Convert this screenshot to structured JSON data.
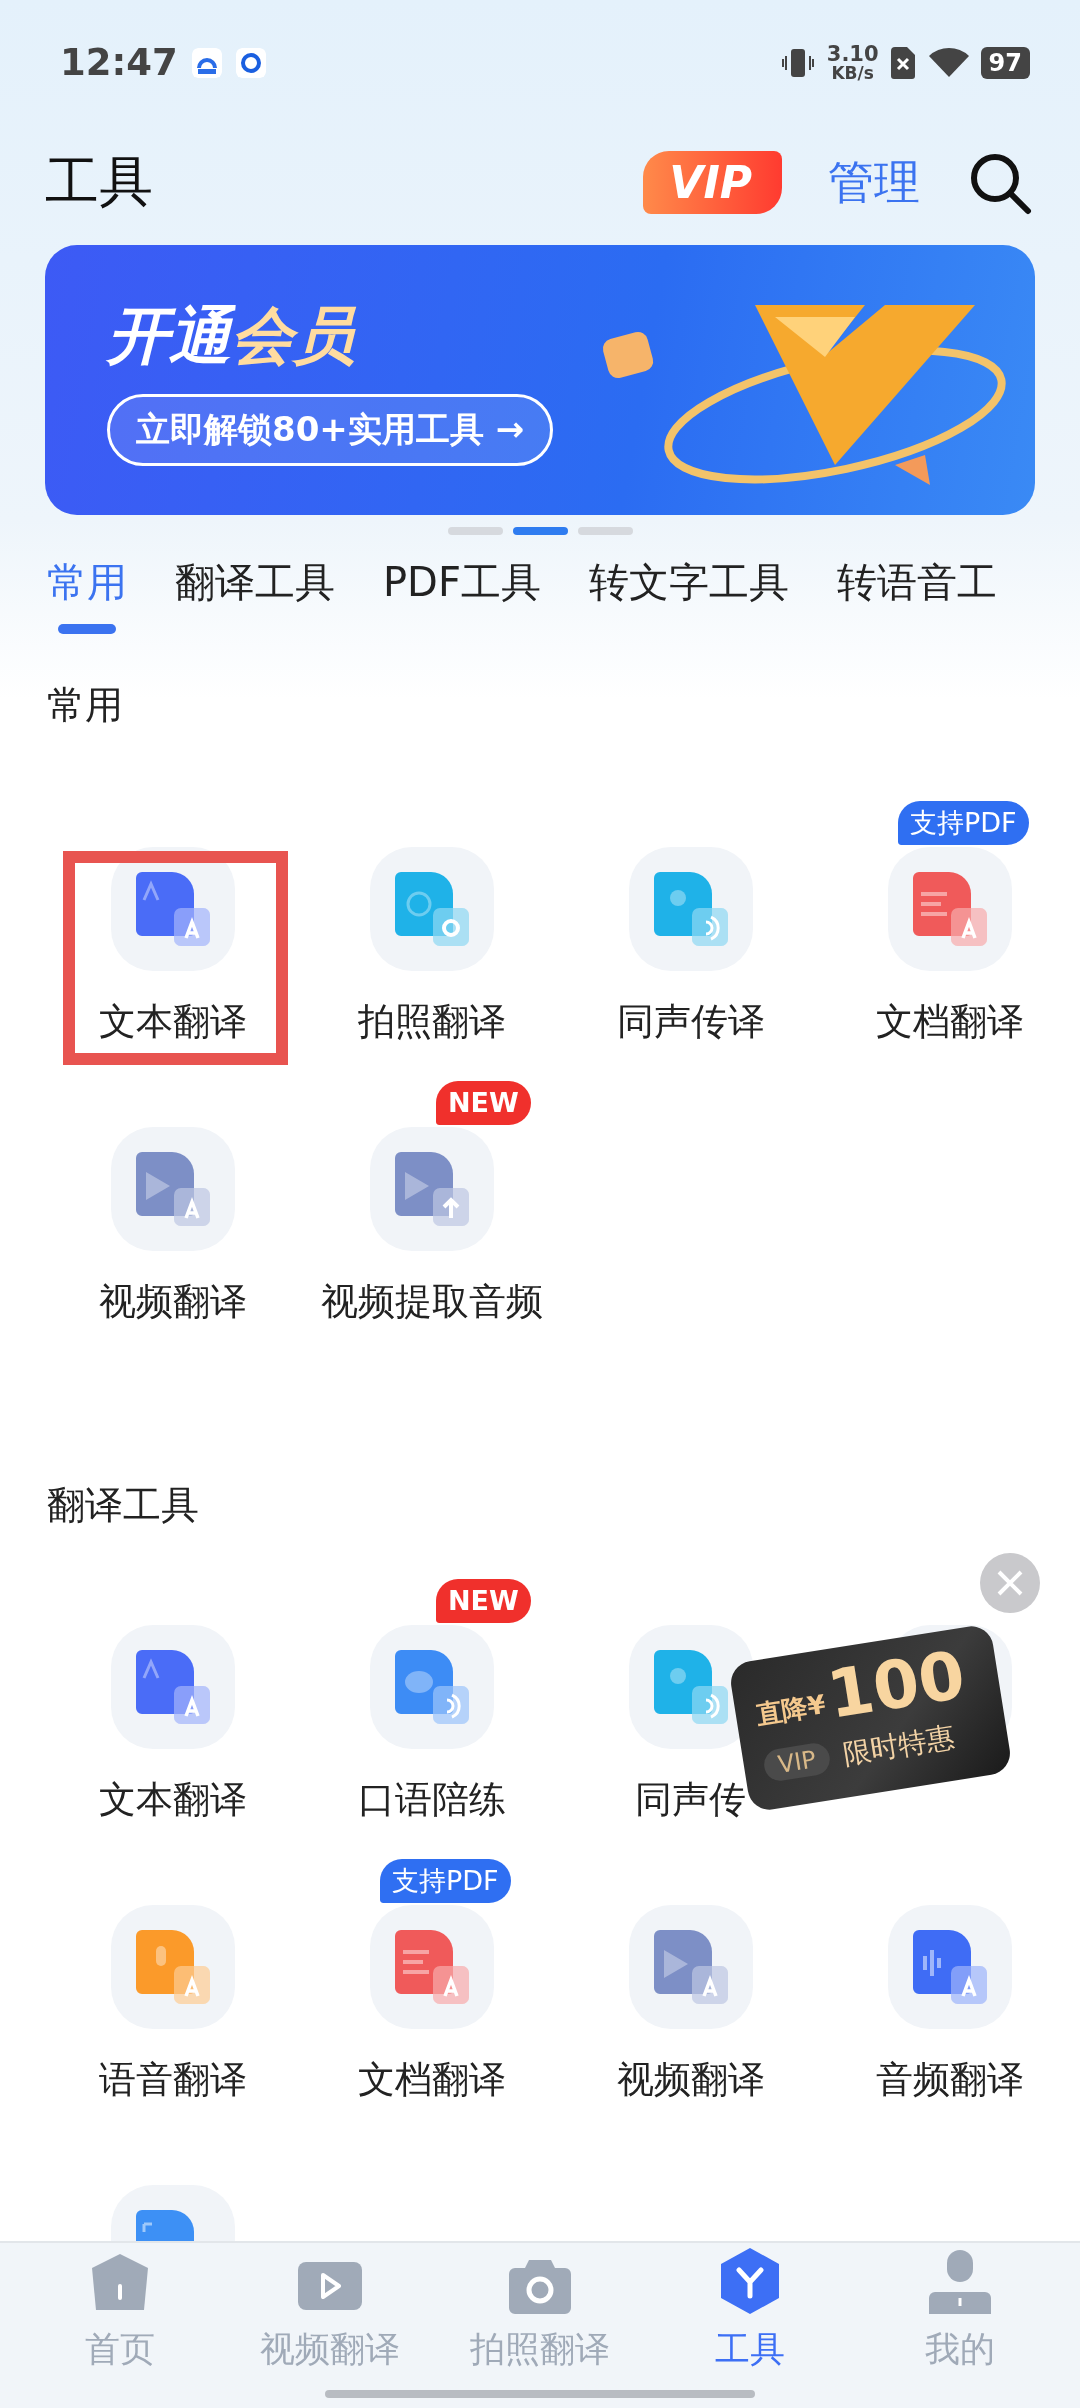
{
  "status_bar": {
    "time": "12:47",
    "net_speed": "3.10",
    "net_unit": "KB/s",
    "battery": "97"
  },
  "header": {
    "title": "工具",
    "vip_badge": "VIP",
    "manage": "管理"
  },
  "banner": {
    "title": "开通",
    "title_highlight": "会员",
    "button": "立即解锁80+实用工具 →"
  },
  "carousel_dots": [
    {
      "selected": false
    },
    {
      "selected": true
    },
    {
      "selected": false
    }
  ],
  "tabs": [
    {
      "label": "常用",
      "selected": true
    },
    {
      "label": "翻译工具",
      "selected": false
    },
    {
      "label": "PDF工具",
      "selected": false
    },
    {
      "label": "转文字工具",
      "selected": false
    },
    {
      "label": "转语音工",
      "selected": false
    }
  ],
  "sections": [
    {
      "title": "常用",
      "items": [
        {
          "label": "文本翻译",
          "kind": "text",
          "highlighted": true
        },
        {
          "label": "拍照翻译",
          "kind": "photo",
          "highlighted": false
        },
        {
          "label": "同声传译",
          "kind": "simul",
          "highlighted": false
        },
        {
          "label": "文档翻译",
          "kind": "doc",
          "highlighted": false,
          "badge": {
            "text": "支持PDF",
            "kind": "pdf"
          }
        },
        {
          "label": "视频翻译",
          "kind": "video",
          "highlighted": false
        },
        {
          "label": "视频提取音频",
          "kind": "extract",
          "highlighted": false,
          "badge": {
            "text": "NEW",
            "kind": "new"
          }
        }
      ]
    },
    {
      "title": "翻译工具",
      "items": [
        {
          "label": "文本翻译",
          "kind": "text",
          "highlighted": false
        },
        {
          "label": "口语陪练",
          "kind": "oral",
          "highlighted": false,
          "badge": {
            "text": "NEW",
            "kind": "new"
          }
        },
        {
          "label": "同声传",
          "kind": "simul",
          "highlighted": false
        },
        {
          "highlighted": false
        },
        {
          "label": "语音翻译",
          "kind": "voice",
          "highlighted": false
        },
        {
          "label": "文档翻译",
          "kind": "doc",
          "highlighted": false,
          "badge": {
            "text": "支持PDF",
            "kind": "pdf"
          }
        },
        {
          "label": "视频翻译",
          "kind": "video",
          "highlighted": false
        },
        {
          "label": "音频翻译",
          "kind": "audio",
          "highlighted": false
        },
        {
          "kind": "scan",
          "highlighted": false
        }
      ]
    }
  ],
  "coupon": {
    "prefix": "直降¥",
    "amount": "100",
    "tag": "VIP",
    "caption": "限时特惠"
  },
  "bottom_nav": [
    {
      "label": "首页",
      "kind": "home",
      "selected": false
    },
    {
      "label": "视频翻译",
      "kind": "video",
      "selected": false
    },
    {
      "label": "拍照翻译",
      "kind": "camera",
      "selected": false
    },
    {
      "label": "工具",
      "kind": "tools",
      "selected": true
    },
    {
      "label": "我的",
      "kind": "person",
      "selected": false
    }
  ]
}
